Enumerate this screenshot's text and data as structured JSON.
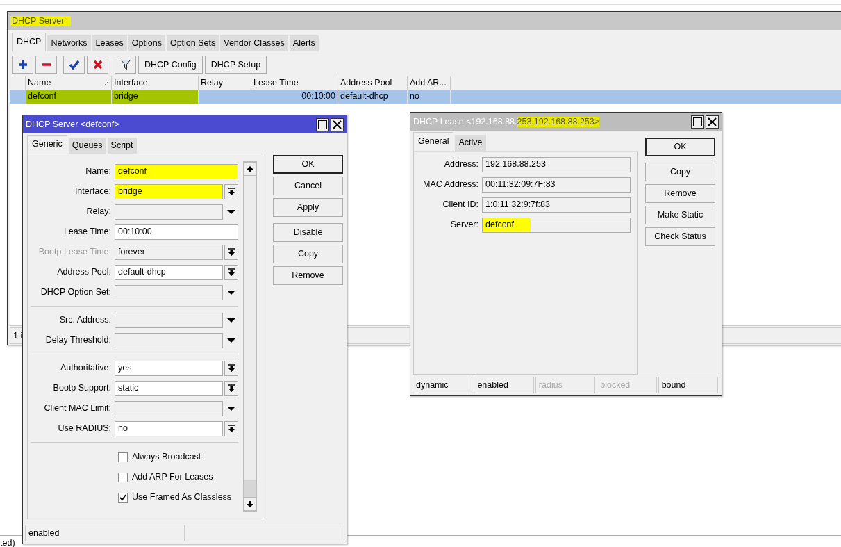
{
  "background": {
    "footer_text": "ted)"
  },
  "main_window": {
    "title": "DHCP Server",
    "title_highlighted": true,
    "tabs": [
      {
        "label": "DHCP",
        "selected": true
      },
      {
        "label": "Networks",
        "selected": false
      },
      {
        "label": "Leases",
        "selected": false
      },
      {
        "label": "Options",
        "selected": false
      },
      {
        "label": "Option Sets",
        "selected": false
      },
      {
        "label": "Vendor Classes",
        "selected": false
      },
      {
        "label": "Alerts",
        "selected": false
      }
    ],
    "toolbar": [
      {
        "kind": "add"
      },
      {
        "kind": "remove"
      },
      {
        "kind": "enable"
      },
      {
        "kind": "disable"
      },
      {
        "kind": "filter"
      },
      {
        "kind": "text",
        "label": "DHCP Config"
      },
      {
        "kind": "text",
        "label": "DHCP Setup"
      }
    ],
    "table": {
      "columns": [
        {
          "label": "Name",
          "sorted": true
        },
        {
          "label": "Interface",
          "sorted": false
        },
        {
          "label": "Relay",
          "sorted": false
        },
        {
          "label": "Lease Time",
          "sorted": false
        },
        {
          "label": "Address Pool",
          "sorted": false
        },
        {
          "label": "Add AR...",
          "sorted": false
        }
      ],
      "rows": [
        {
          "selected": true,
          "highlighted": true,
          "name": "defconf",
          "interface": "bridge",
          "lease_time": "00:10:00",
          "address_pool": "default-dhcp",
          "add_arp": "no"
        }
      ]
    },
    "status_text": "1 i"
  },
  "server_dialog": {
    "title": "DHCP Server <defconf>",
    "active": true,
    "tabs": [
      {
        "label": "Generic",
        "selected": true
      },
      {
        "label": "Queues",
        "selected": false
      },
      {
        "label": "Script",
        "selected": false
      }
    ],
    "fields": [
      {
        "kind": "text",
        "label": "Name:",
        "value": "defconf",
        "highlighted": true
      },
      {
        "kind": "combo",
        "label": "Interface:",
        "value": "bridge",
        "highlighted": true
      },
      {
        "kind": "dropdown",
        "label": "Relay:"
      },
      {
        "kind": "text",
        "label": "Lease Time:",
        "value": "00:10:00"
      },
      {
        "kind": "combo",
        "label": "Bootp Lease Time:",
        "value": "forever",
        "disabled": true
      },
      {
        "kind": "combo",
        "label": "Address Pool:",
        "value": "default-dhcp"
      },
      {
        "kind": "dropdown",
        "label": "DHCP Option Set:"
      },
      {
        "kind": "separator"
      },
      {
        "kind": "dropdown",
        "label": "Src. Address:"
      },
      {
        "kind": "dropdown",
        "label": "Delay Threshold:"
      },
      {
        "kind": "separator"
      },
      {
        "kind": "combo",
        "label": "Authoritative:",
        "value": "yes"
      },
      {
        "kind": "combo",
        "label": "Bootp Support:",
        "value": "static"
      },
      {
        "kind": "dropdown",
        "label": "Client MAC Limit:"
      },
      {
        "kind": "combo",
        "label": "Use RADIUS:",
        "value": "no"
      },
      {
        "kind": "separator"
      }
    ],
    "checkboxes": [
      {
        "label": "Always Broadcast",
        "checked": false
      },
      {
        "label": "Add ARP For Leases",
        "checked": false
      },
      {
        "label": "Use Framed As Classless",
        "checked": true
      }
    ],
    "buttons": [
      {
        "label": "OK",
        "default": true
      },
      {
        "label": "Cancel",
        "default": false
      },
      {
        "label": "Apply",
        "default": false
      },
      {
        "label": "Disable",
        "default": false
      },
      {
        "label": "Copy",
        "default": false
      },
      {
        "label": "Remove",
        "default": false
      }
    ],
    "status": [
      "enabled"
    ]
  },
  "lease_dialog": {
    "active": false,
    "title": [
      {
        "text": "DHCP Lease <192.168.88.",
        "highlighted": false
      },
      {
        "text": "253,192.168.88.253>",
        "highlighted": true
      }
    ],
    "tabs": [
      {
        "label": "General",
        "selected": true
      },
      {
        "label": "Active",
        "selected": false
      }
    ],
    "fields": [
      {
        "label": "Address:",
        "value": "192.168.88.253",
        "highlighted": false
      },
      {
        "label": "MAC Address:",
        "value": "00:11:32:09:7F:83",
        "highlighted": false
      },
      {
        "label": "Client ID:",
        "value": "1:0:11:32:9:7f:83",
        "highlighted": false
      },
      {
        "label": "Server:",
        "value": "defconf",
        "highlighted": true
      }
    ],
    "buttons": [
      {
        "label": "OK",
        "default": true
      },
      {
        "label": "Copy",
        "default": false
      },
      {
        "label": "Remove",
        "default": false
      },
      {
        "label": "Make Static",
        "default": false
      },
      {
        "label": "Check Status",
        "default": false
      }
    ],
    "status": [
      {
        "text": "dynamic",
        "disabled": false
      },
      {
        "text": "enabled",
        "disabled": false
      },
      {
        "text": "radius",
        "disabled": true
      },
      {
        "text": "blocked",
        "disabled": true
      },
      {
        "text": "bound",
        "disabled": false
      }
    ]
  }
}
